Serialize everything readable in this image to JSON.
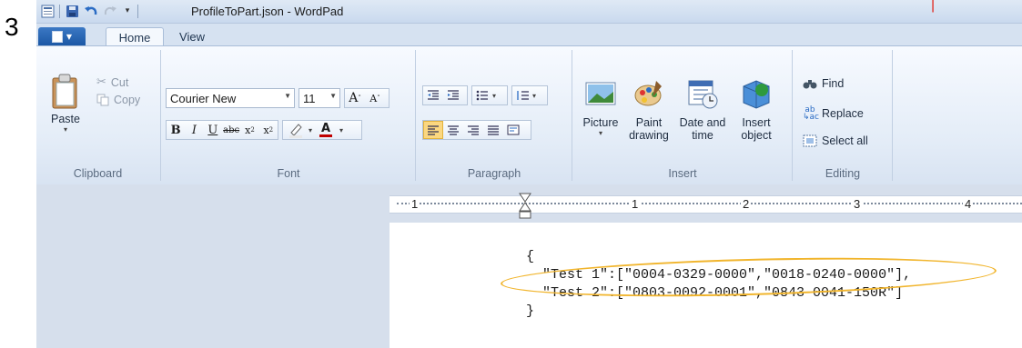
{
  "step_number": "3",
  "window": {
    "title": "ProfileToPart.json - WordPad"
  },
  "colors": {
    "ribbon_bg": "#e3ecf7",
    "app_button": "#1c58a5",
    "highlight": "#f1b52d",
    "selected_align": "#fbd780"
  },
  "tabs": [
    {
      "label": "Home",
      "active": true
    },
    {
      "label": "View",
      "active": false
    }
  ],
  "clipboard": {
    "paste": "Paste",
    "cut": "Cut",
    "copy": "Copy",
    "group": "Clipboard"
  },
  "font": {
    "family": "Courier New",
    "size": "11",
    "group": "Font"
  },
  "paragraph": {
    "group": "Paragraph"
  },
  "insert": {
    "picture": "Picture",
    "paint_1": "Paint",
    "paint_2": "drawing",
    "date_1": "Date and",
    "date_2": "time",
    "object_1": "Insert",
    "object_2": "object",
    "group": "Insert"
  },
  "editing": {
    "find": "Find",
    "replace": "Replace",
    "select_all": "Select all",
    "group": "Editing"
  },
  "ruler": {
    "marks": [
      "1",
      "1",
      "2",
      "3",
      "4"
    ]
  },
  "document": {
    "lines": [
      "{",
      "  \"Test 1\":[\"0004-0329-0000\",\"0018-0240-0000\"],",
      "  \"Test 2\":[\"0803-0092-0001\",\"0843-0041-150R\"]",
      "}"
    ]
  }
}
